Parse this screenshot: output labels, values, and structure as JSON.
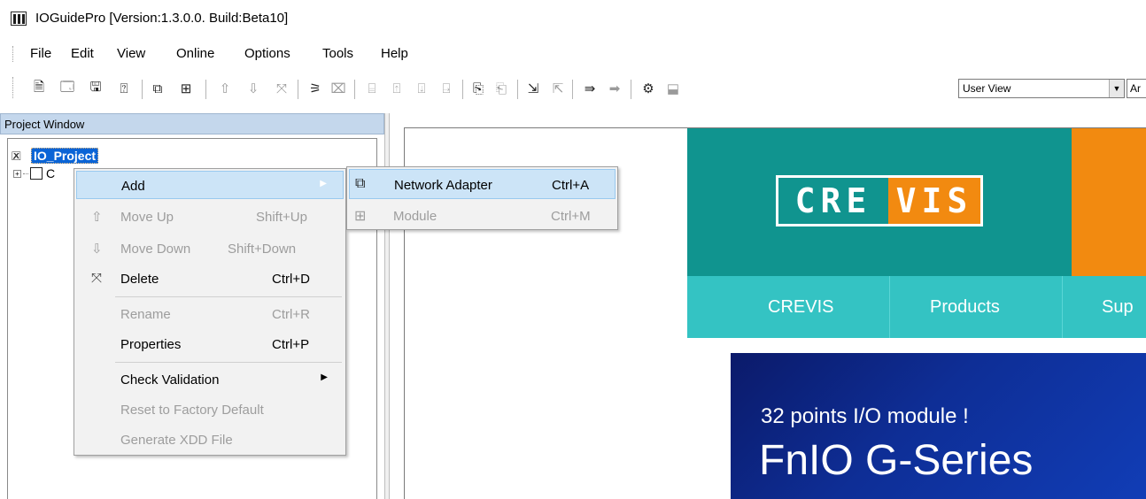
{
  "window": {
    "title": "IOGuidePro  [Version:1.3.0.0. Build:Beta10]"
  },
  "menubar": [
    "File",
    "Edit",
    "View",
    "Online",
    "Options",
    "Tools",
    "Help"
  ],
  "toolbar": {
    "view_select": "User View",
    "view_select2": "Ar"
  },
  "project_window": {
    "header": "Project Window",
    "root_label": "IO_Project",
    "child_label": "C"
  },
  "context_menu": {
    "add": {
      "label": "Add"
    },
    "move_up": {
      "label": "Move Up",
      "shortcut": "Shift+Up"
    },
    "move_down": {
      "label": "Move Down",
      "shortcut": "Shift+Down"
    },
    "delete": {
      "label": "Delete",
      "shortcut": "Ctrl+D"
    },
    "rename": {
      "label": "Rename",
      "shortcut": "Ctrl+R"
    },
    "properties": {
      "label": "Properties",
      "shortcut": "Ctrl+P"
    },
    "check_validation": {
      "label": "Check Validation"
    },
    "reset_factory": {
      "label": "Reset to Factory Default"
    },
    "generate_xdd": {
      "label": "Generate XDD File"
    }
  },
  "submenu": {
    "network_adapter": {
      "label": "Network Adapter",
      "shortcut": "Ctrl+A"
    },
    "module": {
      "label": "Module",
      "shortcut": "Ctrl+M"
    }
  },
  "web": {
    "logo_left": "CRE",
    "logo_right": "VIS",
    "nav": [
      "CREVIS",
      "Products",
      "Sup"
    ],
    "banner_sub": "32 points I/O module !",
    "banner_main": "FnIO G-Series"
  },
  "colors": {
    "crevis_teal": "#10948f",
    "crevis_orange": "#f28a10",
    "nav_teal": "#34c3c3",
    "selection_blue": "#0a64d6",
    "menu_highlight": "#cce4f7"
  }
}
